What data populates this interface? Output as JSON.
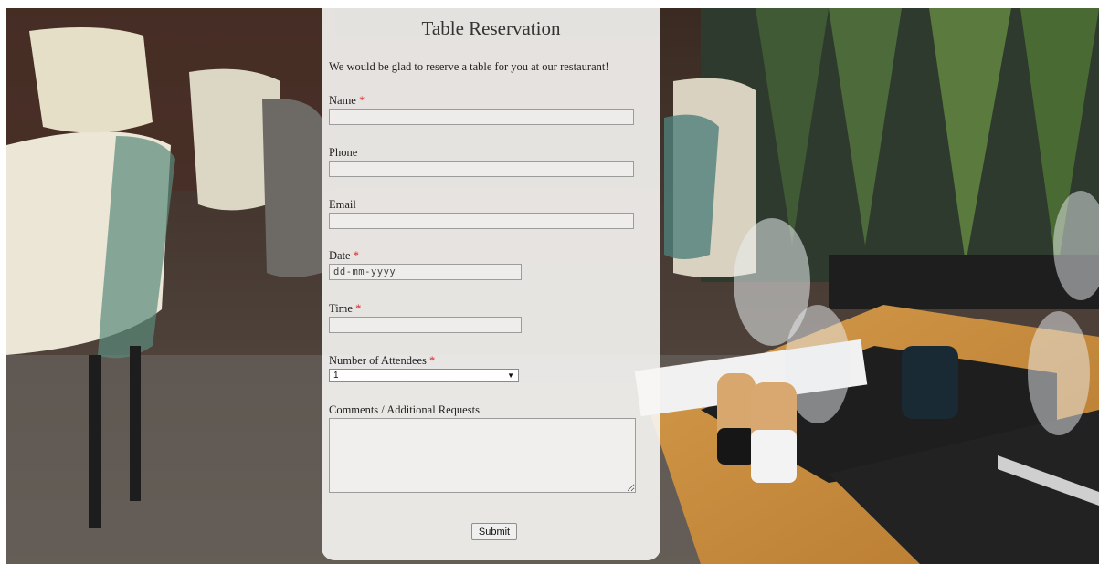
{
  "form": {
    "title": "Table Reservation",
    "intro": "We would be glad to reserve a table for you at our restaurant!",
    "required_marker": "*",
    "fields": {
      "name": {
        "label": "Name",
        "value": ""
      },
      "phone": {
        "label": "Phone",
        "value": ""
      },
      "email": {
        "label": "Email",
        "value": ""
      },
      "date": {
        "label": "Date",
        "placeholder": "dd-mm-yyyy"
      },
      "time": {
        "label": "Time",
        "value": ""
      },
      "attendees": {
        "label": "Number of Attendees",
        "selected": "1",
        "caret": "▼"
      },
      "comments": {
        "label": "Comments / Additional Requests",
        "value": ""
      }
    },
    "submit_label": "Submit"
  },
  "colors": {
    "required": "#dd2222",
    "card": "#f7f6f4"
  }
}
